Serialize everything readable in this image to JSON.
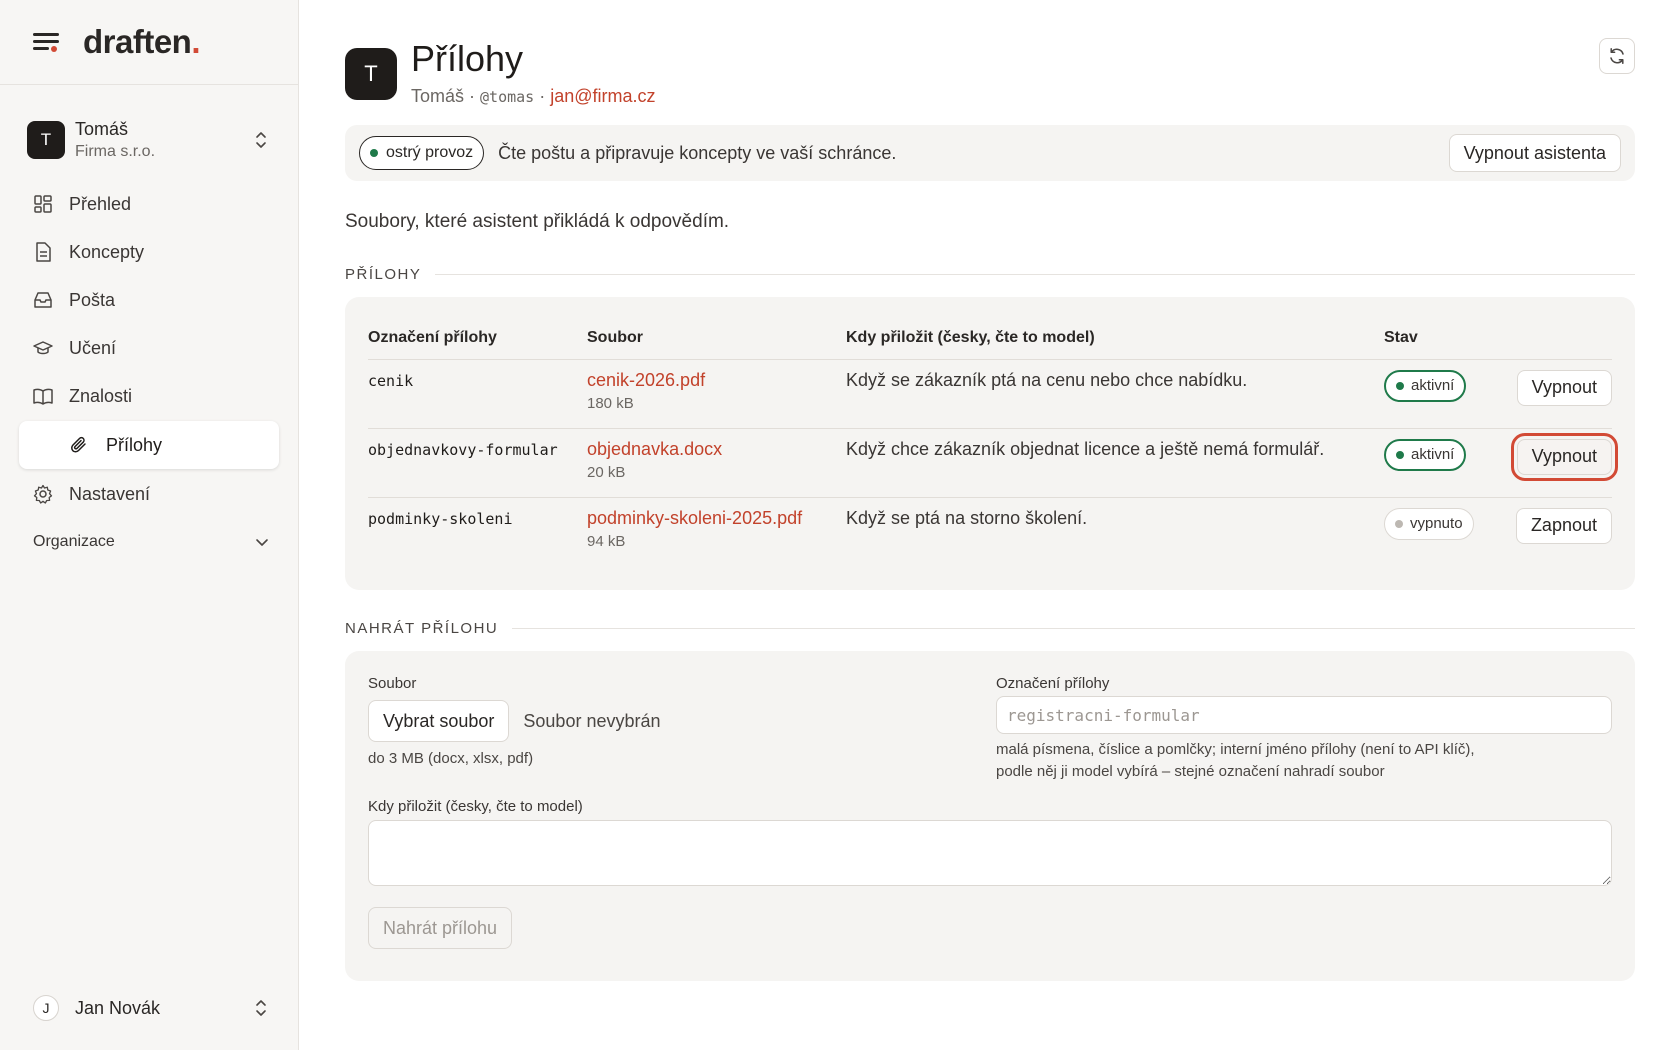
{
  "brand": {
    "name": "draften",
    "dot": "."
  },
  "account": {
    "initial": "T",
    "name": "Tomáš",
    "company": "Firma s.r.o."
  },
  "nav": {
    "items": [
      {
        "label": "Přehled",
        "icon": "dashboard-icon"
      },
      {
        "label": "Koncepty",
        "icon": "document-icon"
      },
      {
        "label": "Pošta",
        "icon": "inbox-icon"
      },
      {
        "label": "Učení",
        "icon": "graduation-cap-icon"
      },
      {
        "label": "Znalosti",
        "icon": "book-icon"
      },
      {
        "label": "Přílohy",
        "icon": "paperclip-icon",
        "active": true
      },
      {
        "label": "Nastavení",
        "icon": "gear-icon"
      }
    ],
    "section": "Organizace"
  },
  "user": {
    "initial": "J",
    "name": "Jan Novák"
  },
  "header": {
    "initial": "T",
    "title": "Přílohy",
    "name": "Tomáš",
    "sep1": " · ",
    "handle": "@tomas",
    "sep2": " · ",
    "email": "jan@firma.cz"
  },
  "banner": {
    "pill": "ostrý provoz",
    "text": "Čte poštu a připravuje koncepty ve vaší schránce.",
    "button": "Vypnout asistenta"
  },
  "intro": "Soubory, které asistent přikládá k odpovědím.",
  "attachments": {
    "section_title": "PŘÍLOHY",
    "columns": [
      "Označení přílohy",
      "Soubor",
      "Kdy přiložit (česky, čte to model)",
      "Stav"
    ],
    "rows": [
      {
        "key": "cenik",
        "file": "cenik-2026.pdf",
        "size": "180 kB",
        "when": "Když se zákazník ptá na cenu nebo chce nabídku.",
        "status": "aktivní",
        "active": true,
        "action": "Vypnout"
      },
      {
        "key": "objednavkovy-formular",
        "file": "objednavka.docx",
        "size": "20 kB",
        "when": "Když chce zákazník objednat licence a ještě nemá formulář.",
        "status": "aktivní",
        "active": true,
        "action": "Vypnout",
        "focused": true
      },
      {
        "key": "podminky-skoleni",
        "file": "podminky-skoleni-2025.pdf",
        "size": "94 kB",
        "when": "Když se ptá na storno školení.",
        "status": "vypnuto",
        "active": false,
        "action": "Zapnout"
      }
    ]
  },
  "upload": {
    "section_title": "NAHRÁT PŘÍLOHU",
    "file_label": "Soubor",
    "choose_button": "Vybrat soubor",
    "no_file": "Soubor nevybrán",
    "file_hint": "do 3 MB (docx, xlsx, pdf)",
    "key_label": "Označení přílohy",
    "key_placeholder": "registracni-formular",
    "key_hint_1": "malá písmena, číslice a pomlčky; interní jméno přílohy (není to API klíč),",
    "key_hint_2": "podle něj ji model vybírá – stejné označení nahradí soubor",
    "when_label": "Kdy přiložit (česky, čte to model)",
    "when_value": "",
    "submit": "Nahrát přílohu"
  },
  "colors": {
    "accent": "#d24a35",
    "link": "#c2422b",
    "active_green": "#1f7a4a"
  }
}
